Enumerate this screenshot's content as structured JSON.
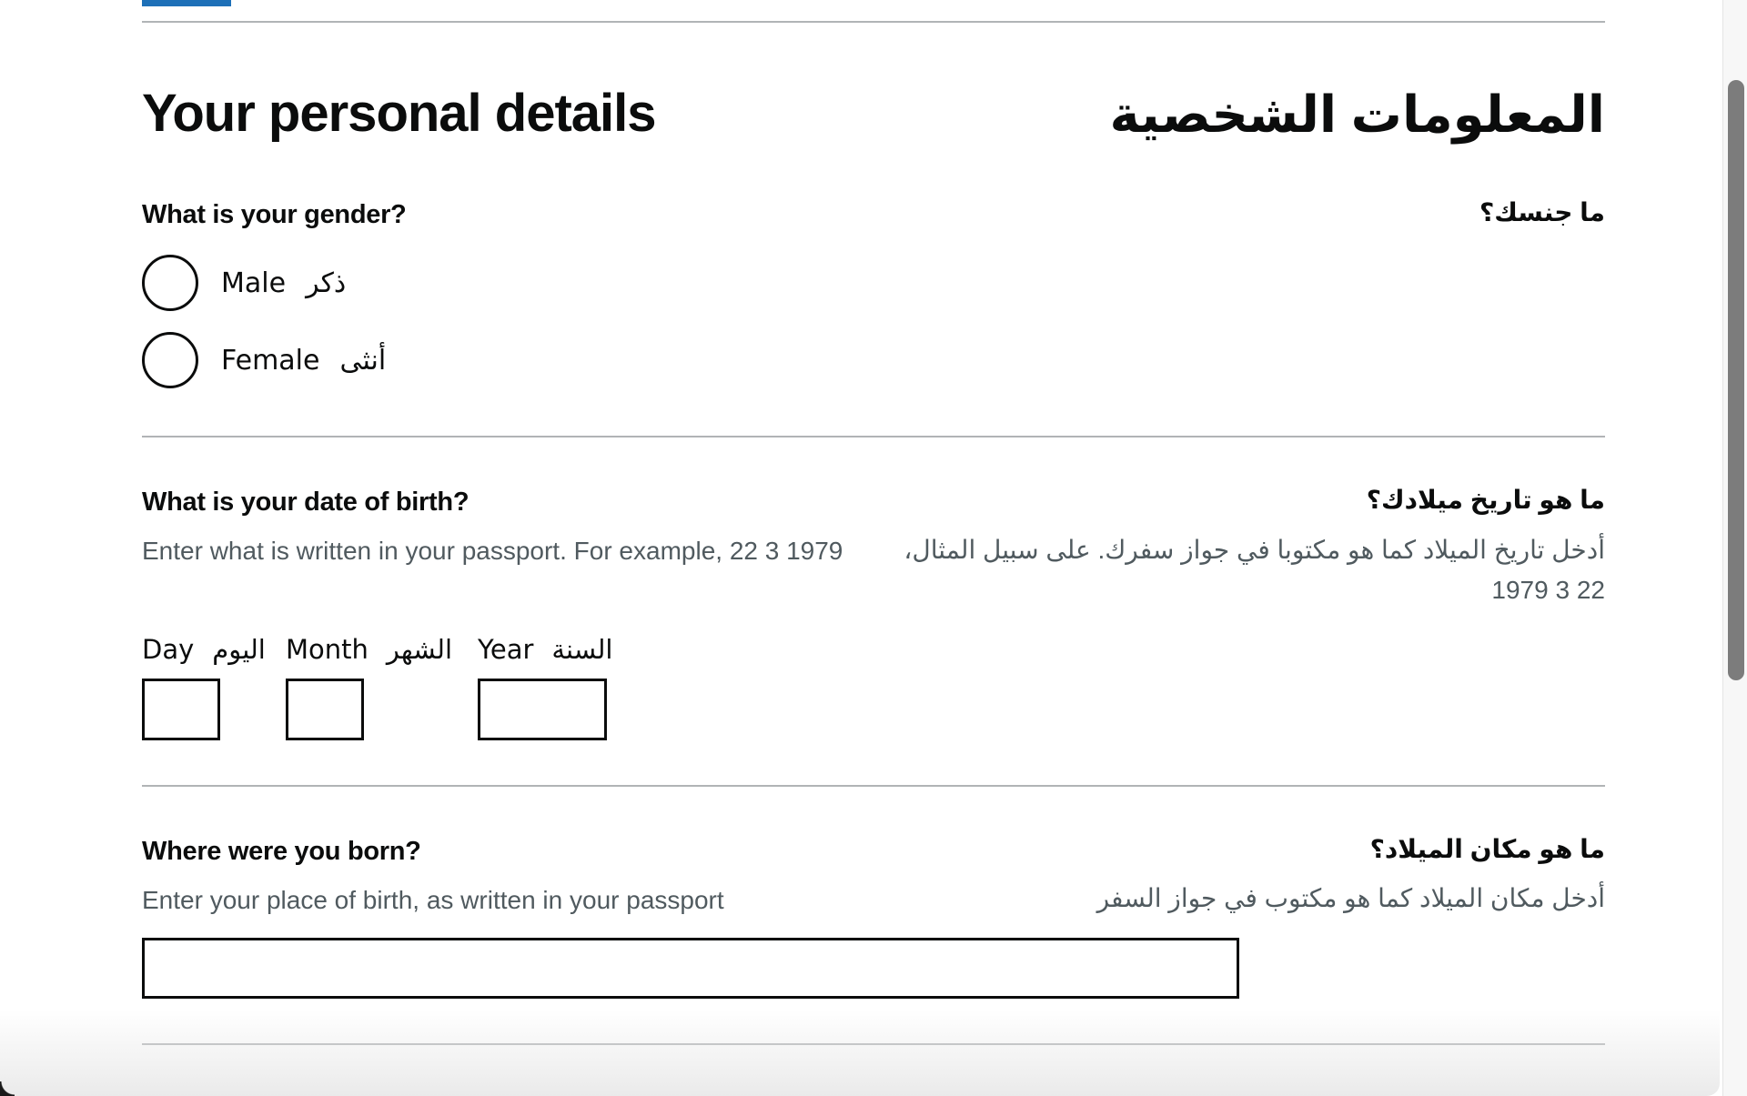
{
  "progress": {
    "accent_color": "#1d70b8"
  },
  "heading": {
    "title_en": "Your personal details",
    "title_ar": "المعلومات الشخصية"
  },
  "gender": {
    "question_en": "What is your gender?",
    "question_ar": "ما جنسك؟",
    "options": [
      {
        "label_en": "Male",
        "label_ar": "ذكر",
        "selected": false
      },
      {
        "label_en": "Female",
        "label_ar": "أنثى",
        "selected": false
      }
    ]
  },
  "dob": {
    "question_en": "What is your date of birth?",
    "question_ar": "ما هو تاريخ ميلادك؟",
    "hint_en": "Enter what is written in your passport. For example, 22 3 1979",
    "hint_ar": "أدخل تاريخ الميلاد كما هو مكتوبا في جواز سفرك. على سبيل المثال، 22 3 1979",
    "fields": [
      {
        "label_en": "Day",
        "label_ar": "اليوم",
        "value": ""
      },
      {
        "label_en": "Month",
        "label_ar": "الشهر",
        "value": ""
      },
      {
        "label_en": "Year",
        "label_ar": "السنة",
        "value": ""
      }
    ]
  },
  "birthplace": {
    "question_en": "Where were you born?",
    "question_ar": "ما هو مكان الميلاد؟",
    "hint_en": "Enter your place of birth, as written in your passport",
    "hint_ar": "أدخل مكان الميلاد كما هو مكتوب في جواز السفر",
    "value": ""
  },
  "scrollbar": {
    "position_fraction": 0.07,
    "visible_fraction": 0.55
  }
}
